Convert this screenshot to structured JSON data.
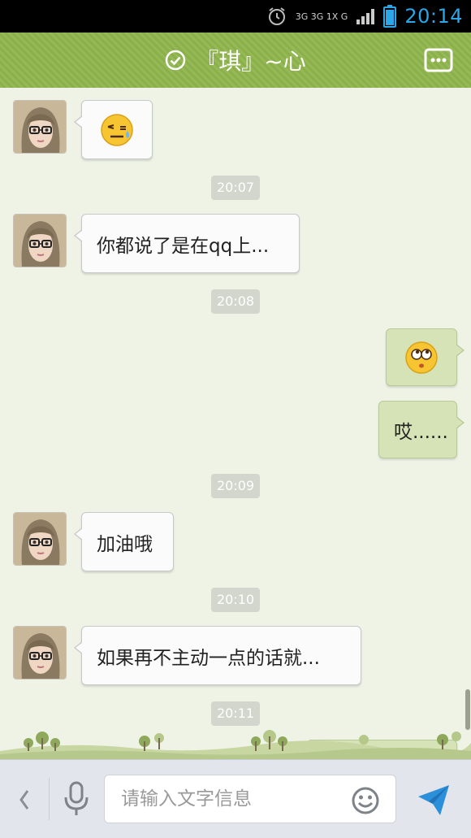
{
  "status_bar": {
    "time": "20:14",
    "network_label": "3G 3G 1X G",
    "icons": [
      "alarm-icon",
      "signal-icon",
      "battery-icon"
    ]
  },
  "header": {
    "title": "『琪』~心",
    "icons": [
      "verified-check-icon",
      "more-options-icon"
    ]
  },
  "messages": [
    {
      "side": "left",
      "type": "emoji",
      "emoji": "sweat-smiley"
    },
    {
      "side": "center",
      "type": "time",
      "text": "20:07"
    },
    {
      "side": "left",
      "type": "text",
      "text": "你都说了是在qq上..."
    },
    {
      "side": "center",
      "type": "time",
      "text": "20:08"
    },
    {
      "side": "right",
      "type": "emoji",
      "emoji": "rolling-eyes-smiley"
    },
    {
      "side": "right",
      "type": "text",
      "text": "哎......"
    },
    {
      "side": "center",
      "type": "time",
      "text": "20:09"
    },
    {
      "side": "left",
      "type": "text",
      "text": "加油哦"
    },
    {
      "side": "center",
      "type": "time",
      "text": "20:10"
    },
    {
      "side": "left",
      "type": "text",
      "text": "如果再不主动一点的话就..."
    },
    {
      "side": "center",
      "type": "time",
      "text": "20:11"
    }
  ],
  "input_bar": {
    "placeholder": "请输入文字信息",
    "icons": [
      "back-chevron-icon",
      "microphone-icon",
      "emoji-smiley-icon",
      "send-icon"
    ]
  },
  "colors": {
    "header_green": "#8fb54c",
    "chat_background": "#eef3e6",
    "sent_bubble": "#d6e3b6",
    "received_bubble": "#fbfbfb",
    "time_accent": "#29a7e8",
    "send_blue": "#2c8fd9"
  }
}
